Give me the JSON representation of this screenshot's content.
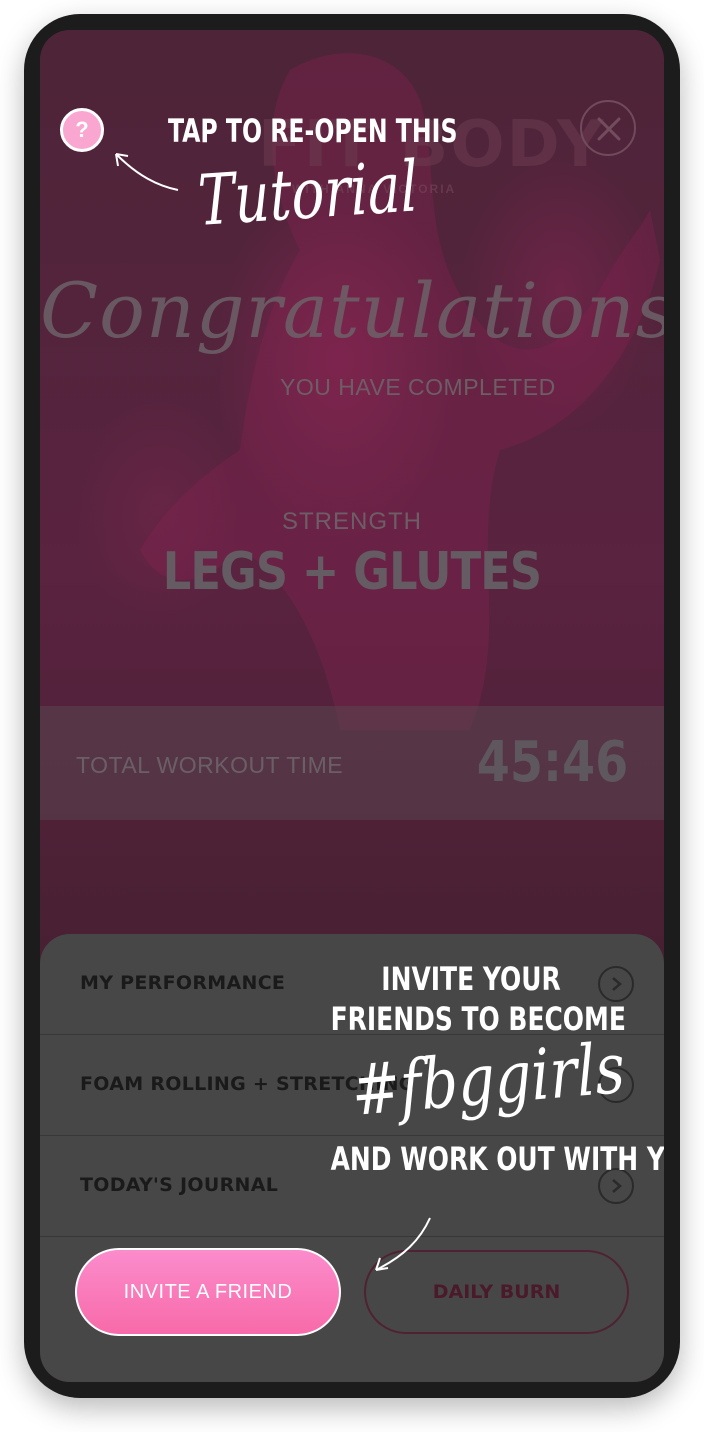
{
  "logo": {
    "brand": "FIT BODY",
    "subtitle": "WITH ANNA VICTORIA"
  },
  "result": {
    "headline": "Congratulations!",
    "completed_text": "YOU HAVE COMPLETED",
    "category": "STRENGTH",
    "workout_name": "LEGS + GLUTES",
    "total_time_label": "TOTAL WORKOUT TIME",
    "total_time_value": "45:46"
  },
  "menu": {
    "items": [
      {
        "label": "MY PERFORMANCE",
        "icon": "chevron-right-icon"
      },
      {
        "label": "FOAM ROLLING + STRETCHING",
        "icon": "chevron-right-icon"
      },
      {
        "label": "TODAY'S JOURNAL",
        "icon": "chevron-right-icon"
      }
    ]
  },
  "buttons": {
    "invite": "INVITE A FRIEND",
    "daily_burn": "DAILY BURN"
  },
  "tutorial": {
    "help_icon": "question-mark-icon",
    "close_icon": "close-icon",
    "help_symbol": "?",
    "reopen_line": "TAP TO RE-OPEN THIS",
    "reopen_script": "Tutorial",
    "invite_line1": "INVITE YOUR",
    "invite_line2": "FRIENDS TO BECOME",
    "invite_hashtag": "#fbggirls",
    "invite_line3": "AND WORK OUT WITH YOU!"
  },
  "colors": {
    "overlay": "#4a1f35",
    "sheet": "#474747",
    "invite_button": "#f86aa9",
    "help_button": "#f9a7d1"
  }
}
